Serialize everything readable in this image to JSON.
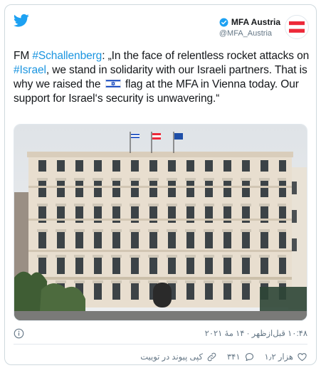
{
  "author": {
    "name": "MFA Austria",
    "handle": "@MFA_Austria"
  },
  "tweet": {
    "prefix": "FM ",
    "hashtag_person": "#Schallenberg",
    "part1": ": „In the face of relentless rocket attacks on ",
    "hashtag_country": "#Israel",
    "part2": ", we stand in solidarity with our Israeli partners. That is why we raised the",
    "part3": "flag at the MFA in Vienna today. Our support for Israel‘s security is unwavering.“"
  },
  "meta": {
    "timestamp": "۱۰:۴۸ قبل‌ازظهر · ۱۴ مهٔ ۲۰۲۱"
  },
  "actions": {
    "likes": "۱٫۲ هزار",
    "replies": "۳۴۱",
    "copy_link": "کپی پیوند در توییت"
  },
  "colors": {
    "link": "#1b95e0",
    "bird": "#1da1f2",
    "austria_red": "#ed2939",
    "israel_blue": "#0038b8"
  },
  "icons": {
    "brand": "twitter-bird-icon",
    "verified": "verified-badge-icon",
    "info": "info-icon",
    "like": "heart-icon",
    "reply": "reply-bubble-icon",
    "share": "link-icon"
  }
}
